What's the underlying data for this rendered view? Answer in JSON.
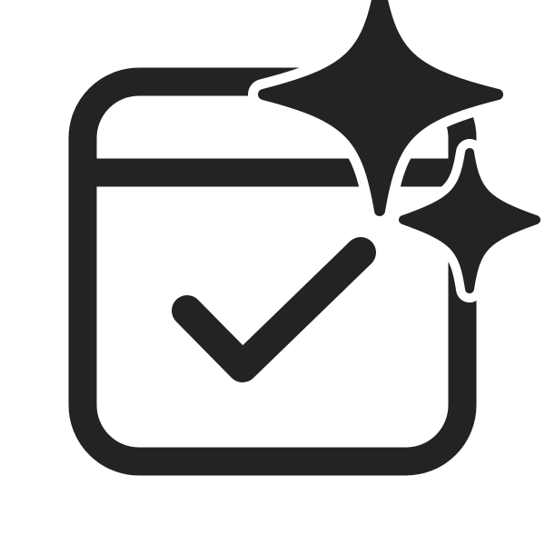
{
  "icon": {
    "name": "calendar-checkmark-sparkle-icon",
    "color": "#232323",
    "background": "#ffffff"
  }
}
